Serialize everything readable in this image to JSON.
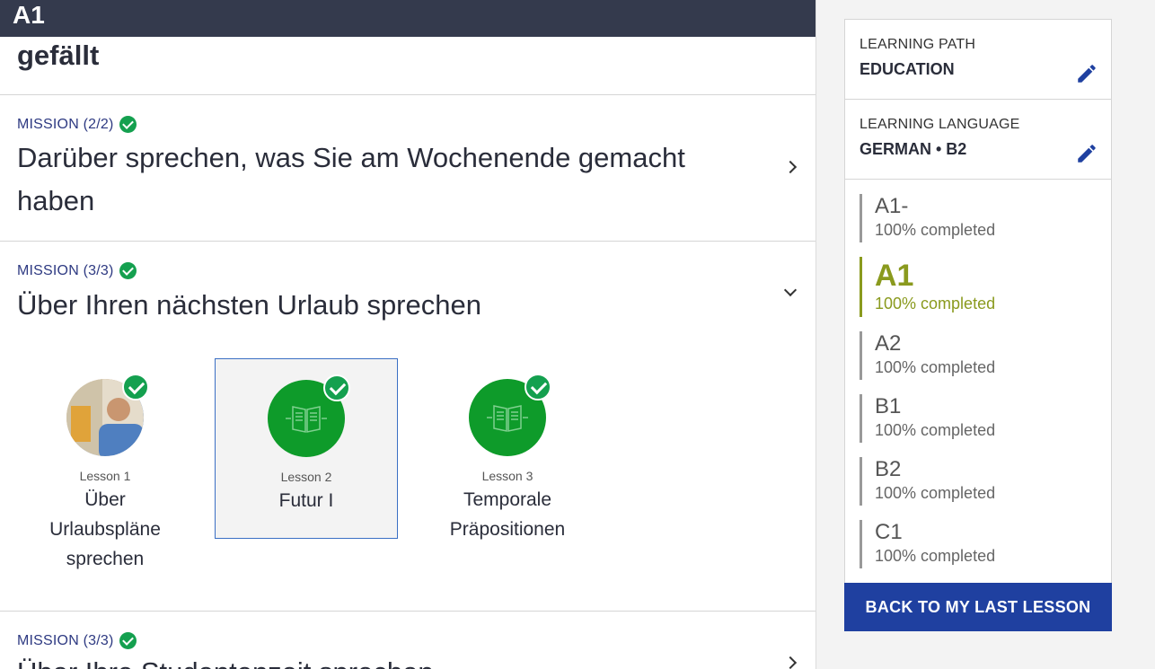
{
  "topbar": {
    "title": "A1"
  },
  "prev_section": {
    "title": "gefällt"
  },
  "missions": [
    {
      "label": "MISSION (2/2)",
      "title": "Darüber sprechen, was Sie am Wochenende gemacht haben"
    },
    {
      "label": "MISSION (3/3)",
      "title": "Über Ihren nächsten Urlaub sprechen"
    },
    {
      "label": "MISSION (3/3)",
      "title": "Über Ihre Studentenzeit sprechen"
    }
  ],
  "lessons": [
    {
      "number": "Lesson 1",
      "name": "Über Urlaubspläne sprechen",
      "image": "photo-thumbnail"
    },
    {
      "number": "Lesson 2",
      "name": "Futur I",
      "image": "book-icon"
    },
    {
      "number": "Lesson 3",
      "name": "Temporale Präpositionen",
      "image": "book-icon"
    }
  ],
  "sidebar": {
    "learning_path_label": "LEARNING PATH",
    "learning_path_value": "EDUCATION",
    "learning_language_label": "LEARNING LANGUAGE",
    "learning_language_value": "GERMAN • B2",
    "levels": [
      {
        "name": "A1-",
        "progress": "100% completed"
      },
      {
        "name": "A1",
        "progress": "100% completed",
        "current": true
      },
      {
        "name": "A2",
        "progress": "100% completed"
      },
      {
        "name": "B1",
        "progress": "100% completed"
      },
      {
        "name": "B2",
        "progress": "100% completed"
      },
      {
        "name": "C1",
        "progress": "100% completed"
      }
    ],
    "back_button": "BACK TO MY LAST LESSON"
  },
  "colors": {
    "topbar": "#343a4d",
    "accent": "#1f40a0",
    "check": "#14a04f",
    "current_level": "#8a9a1e",
    "lesson_green": "#0e9b2a"
  }
}
